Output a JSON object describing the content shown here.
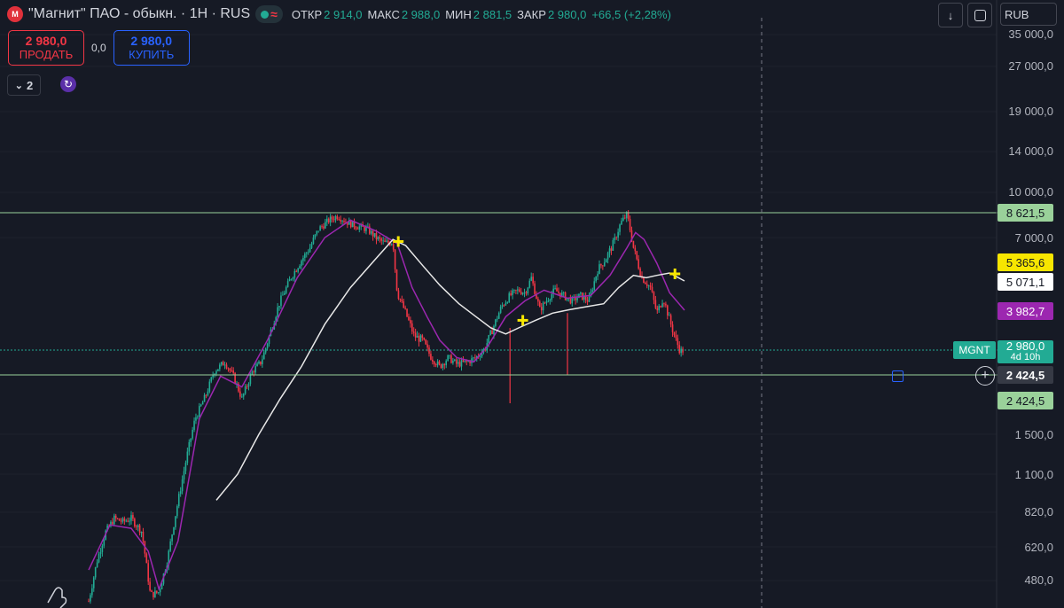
{
  "header": {
    "logo_text": "М",
    "title": "\"Магнит\" ПАО - обыкн. · 1Н · RUS",
    "ohlc": [
      {
        "label": "ОТКР",
        "value": "2 914,0"
      },
      {
        "label": "МАКС",
        "value": "2 988,0"
      },
      {
        "label": "МИН",
        "value": "2 881,5"
      },
      {
        "label": "ЗАКР",
        "value": "2 980,0"
      }
    ],
    "change": "+66,5 (+2,28%)",
    "accent_up": "#22ab94",
    "accent_down": "#f23645"
  },
  "trade": {
    "sell_price": "2 980,0",
    "sell_label": "ПРОДАТЬ",
    "spread": "0,0",
    "buy_price": "2 980,0",
    "buy_label": "КУПИТЬ"
  },
  "indicators": {
    "collapsed_count": "2"
  },
  "toolbar": {
    "currency": "RUB",
    "download_icon": "arrow-down-icon",
    "fullscreen_icon": "fullscreen-icon"
  },
  "price_axis": {
    "ticks": [
      "35 000,0",
      "27 000,0",
      "19 000,0",
      "14 000,0",
      "10 000,0",
      "7 000,0",
      "1 500,0",
      "1 100,0",
      "820,0",
      "620,0",
      "480,0"
    ]
  },
  "price_tags": {
    "resistance": "8 621,5",
    "yellow_ma": "5 365,6",
    "white_ma": "5 071,1",
    "purple_ma": "3 982,7",
    "symbol": "MGNT",
    "last_price": "2 980,0",
    "countdown": "4d 10h",
    "crosshair": "2 424,5",
    "support": "2 424,5"
  },
  "chart_data": {
    "type": "candlestick",
    "symbol": "MGNT",
    "scale": "log",
    "ylim": [
      400,
      40000
    ],
    "horizontal_lines": [
      8621.5,
      2424.5
    ],
    "last_price": 2980.0,
    "price_trajectory": [
      [
        0,
        410
      ],
      [
        8,
        560
      ],
      [
        16,
        700
      ],
      [
        24,
        780
      ],
      [
        32,
        760
      ],
      [
        40,
        780
      ],
      [
        50,
        700
      ],
      [
        58,
        430
      ],
      [
        66,
        440
      ],
      [
        74,
        560
      ],
      [
        82,
        820
      ],
      [
        92,
        1250
      ],
      [
        100,
        1700
      ],
      [
        110,
        2050
      ],
      [
        118,
        2500
      ],
      [
        128,
        2700
      ],
      [
        136,
        2400
      ],
      [
        144,
        2000
      ],
      [
        154,
        2500
      ],
      [
        162,
        2700
      ],
      [
        172,
        3500
      ],
      [
        180,
        4300
      ],
      [
        190,
        5200
      ],
      [
        198,
        5800
      ],
      [
        208,
        6500
      ],
      [
        216,
        7500
      ],
      [
        226,
        8100
      ],
      [
        234,
        8400
      ],
      [
        242,
        8000
      ],
      [
        252,
        7700
      ],
      [
        262,
        7500
      ],
      [
        270,
        7000
      ],
      [
        278,
        6700
      ],
      [
        286,
        6800
      ],
      [
        290,
        4600
      ],
      [
        298,
        3900
      ],
      [
        306,
        3300
      ],
      [
        314,
        3200
      ],
      [
        322,
        2800
      ],
      [
        330,
        2600
      ],
      [
        338,
        2800
      ],
      [
        346,
        2650
      ],
      [
        356,
        2700
      ],
      [
        364,
        2800
      ],
      [
        372,
        3000
      ],
      [
        380,
        3500
      ],
      [
        388,
        4100
      ],
      [
        396,
        4500
      ],
      [
        404,
        4700
      ],
      [
        410,
        4600
      ],
      [
        416,
        5200
      ],
      [
        424,
        4000
      ],
      [
        430,
        4300
      ],
      [
        438,
        4700
      ],
      [
        446,
        4500
      ],
      [
        454,
        4300
      ],
      [
        462,
        4500
      ],
      [
        470,
        4300
      ],
      [
        478,
        5500
      ],
      [
        486,
        6000
      ],
      [
        494,
        6800
      ],
      [
        500,
        7900
      ],
      [
        506,
        8500
      ],
      [
        512,
        6500
      ],
      [
        520,
        5200
      ],
      [
        528,
        4800
      ],
      [
        534,
        3900
      ],
      [
        540,
        4400
      ],
      [
        546,
        3700
      ],
      [
        552,
        3200
      ],
      [
        556,
        2950
      ],
      [
        560,
        2980
      ]
    ],
    "ma_purple": [
      [
        0,
        520
      ],
      [
        20,
        740
      ],
      [
        40,
        720
      ],
      [
        56,
        600
      ],
      [
        66,
        450
      ],
      [
        84,
        650
      ],
      [
        104,
        1700
      ],
      [
        124,
        2400
      ],
      [
        144,
        2200
      ],
      [
        168,
        3200
      ],
      [
        196,
        5200
      ],
      [
        222,
        7000
      ],
      [
        246,
        8100
      ],
      [
        270,
        7400
      ],
      [
        290,
        6700
      ],
      [
        304,
        4800
      ],
      [
        318,
        3800
      ],
      [
        330,
        3200
      ],
      [
        346,
        2800
      ],
      [
        362,
        2700
      ],
      [
        376,
        3100
      ],
      [
        392,
        3800
      ],
      [
        410,
        4300
      ],
      [
        428,
        4700
      ],
      [
        450,
        4400
      ],
      [
        472,
        4500
      ],
      [
        490,
        5300
      ],
      [
        506,
        6500
      ],
      [
        514,
        7300
      ],
      [
        522,
        6900
      ],
      [
        534,
        5800
      ],
      [
        546,
        4600
      ],
      [
        560,
        3982.7
      ]
    ],
    "ma_white": [
      [
        120,
        900
      ],
      [
        140,
        1100
      ],
      [
        160,
        1500
      ],
      [
        180,
        2000
      ],
      [
        200,
        2600
      ],
      [
        222,
        3600
      ],
      [
        246,
        4800
      ],
      [
        270,
        6000
      ],
      [
        286,
        6900
      ],
      [
        298,
        6600
      ],
      [
        314,
        5700
      ],
      [
        330,
        4900
      ],
      [
        348,
        4200
      ],
      [
        364,
        3800
      ],
      [
        378,
        3500
      ],
      [
        392,
        3350
      ],
      [
        404,
        3500
      ],
      [
        420,
        3700
      ],
      [
        436,
        3900
      ],
      [
        452,
        4000
      ],
      [
        468,
        4100
      ],
      [
        484,
        4200
      ],
      [
        498,
        4800
      ],
      [
        512,
        5300
      ],
      [
        524,
        5200
      ],
      [
        534,
        5300
      ],
      [
        546,
        5400
      ],
      [
        560,
        5071.1
      ]
    ],
    "markers": [
      {
        "x": 291,
        "y": 6800
      },
      {
        "x": 408,
        "y": 3700
      },
      {
        "x": 551,
        "y": 5365.6
      }
    ]
  }
}
